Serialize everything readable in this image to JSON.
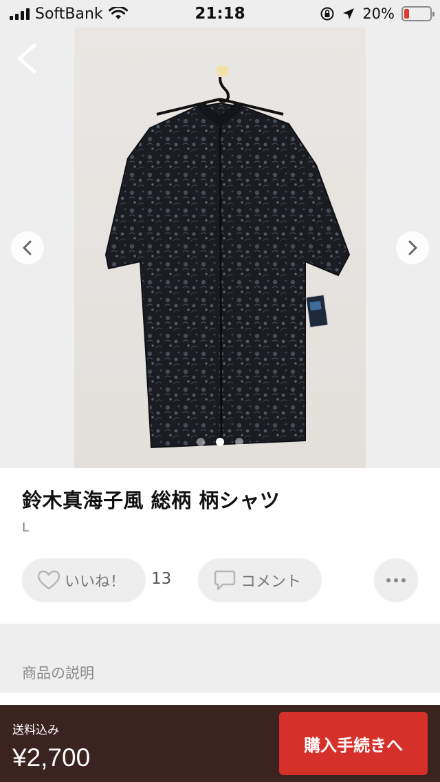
{
  "status_bar": {
    "carrier": "SoftBank",
    "time": "21:18",
    "battery_percent": "20%",
    "battery_level": 0.2,
    "icons": [
      "signal-icon",
      "wifi-icon",
      "orientation-lock-icon",
      "location-icon",
      "battery-icon"
    ]
  },
  "gallery": {
    "image_count": 3,
    "active_index": 1,
    "icons": [
      "back-chevron-icon",
      "chevron-left-icon",
      "chevron-right-icon"
    ]
  },
  "product": {
    "title": "鈴木真海子風 総柄 柄シャツ",
    "size": "L"
  },
  "actions": {
    "like_label": "いいね！",
    "like_count": "13",
    "comment_label": "コメント",
    "icons": [
      "heart-icon",
      "comment-icon",
      "more-icon"
    ]
  },
  "description": {
    "heading": "商品の説明"
  },
  "purchase": {
    "shipping_label": "送料込み",
    "price": "¥2,700",
    "buy_label": "購入手続きへ"
  },
  "colors": {
    "status_bg": "#eeeeee",
    "bottom_bar": "#3b2320",
    "buy_button": "#d6302b",
    "battery_low": "#e03a2f"
  }
}
